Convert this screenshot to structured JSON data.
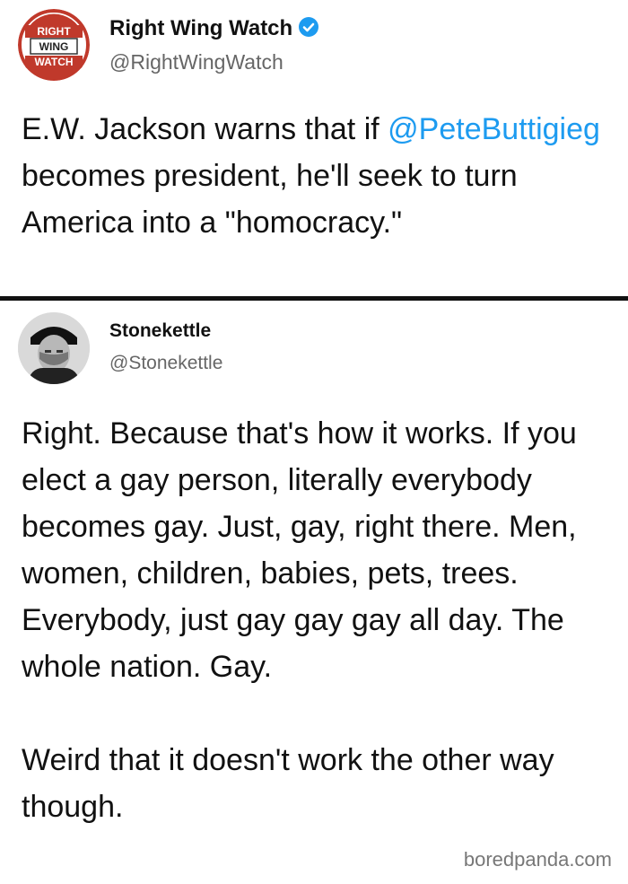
{
  "tweets": [
    {
      "display_name": "Right Wing Watch",
      "handle": "@RightWingWatch",
      "verified": true,
      "logo_text": [
        "RIGHT",
        "WING",
        "WATCH"
      ],
      "body_before_mention": "E.W. Jackson warns that if ",
      "mention": "@PeteButtigieg",
      "body_after_mention": " becomes president, he'll seek to turn America into a \"homocracy.\""
    },
    {
      "display_name": "Stonekettle",
      "handle": "@Stonekettle",
      "verified": false,
      "body_paragraph_1": "Right. Because that's how it works. If you elect a gay person, literally everybody becomes gay. Just, gay, right there. Men, women, children, babies, pets, trees. Everybody, just gay gay gay all day. The whole nation. Gay.",
      "body_paragraph_2": "Weird that it doesn't work the other way though."
    }
  ],
  "watermark": "boredpanda.com",
  "colors": {
    "mention": "#1d9bf0",
    "logo_red": "#c0392b",
    "divider": "#111111"
  }
}
